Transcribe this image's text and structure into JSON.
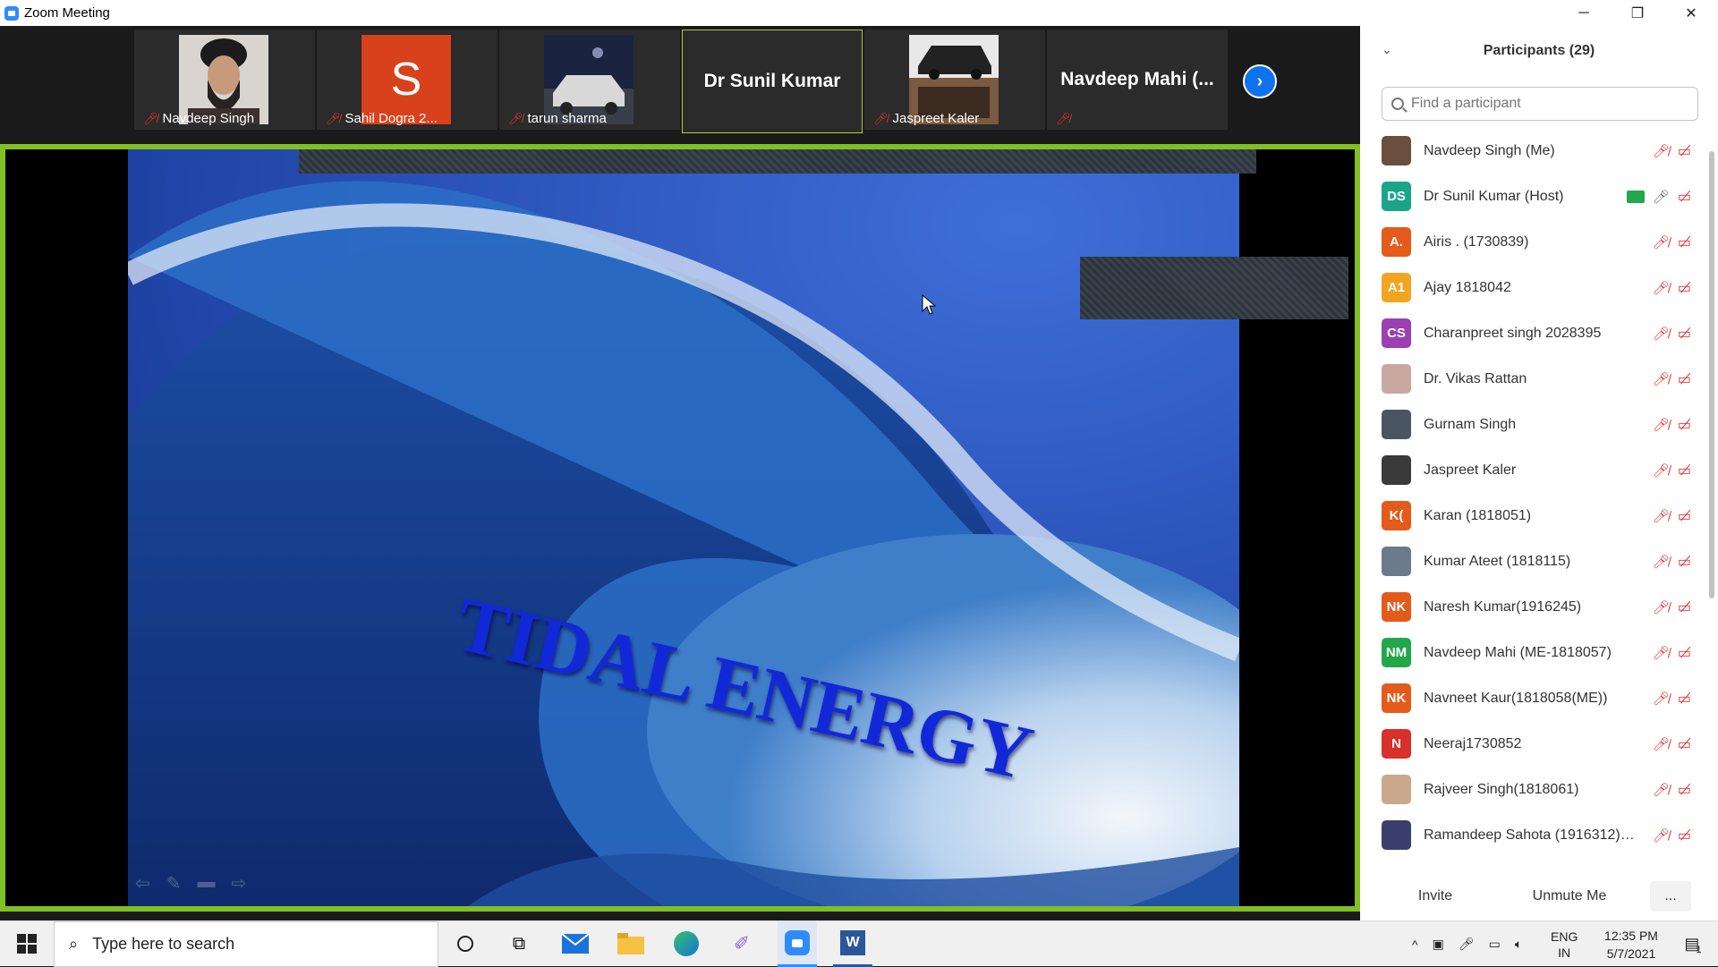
{
  "window": {
    "title": "Zoom Meeting",
    "minimize": "─",
    "restore": "❐",
    "close": "✕"
  },
  "strip": {
    "tiles": [
      {
        "name": "Navdeep Singh"
      },
      {
        "name": "Sahil Dogra 2...",
        "initial": "S"
      },
      {
        "name": "tarun sharma"
      },
      {
        "name": "Dr Sunil Kumar"
      },
      {
        "name": "Jaspreet Kaler"
      },
      {
        "name": "Navdeep  Mahi (..."
      }
    ],
    "next_icon": "chevron-right-icon"
  },
  "slide": {
    "title": "TIDAL ENERGY"
  },
  "sidebar": {
    "header": "Participants (29)",
    "search_placeholder": "Find a participant",
    "participants": [
      {
        "name": "Navdeep Singh (Me)",
        "initials": "",
        "color": "#6b4e3d"
      },
      {
        "name": "Dr Sunil Kumar (Host)",
        "initials": "DS",
        "color": "#1aa58b"
      },
      {
        "name": "Airis . (1730839)",
        "initials": "A.",
        "color": "#e45a1b"
      },
      {
        "name": "Ajay 1818042",
        "initials": "A1",
        "color": "#f2a521"
      },
      {
        "name": "Charanpreet singh 2028395",
        "initials": "CS",
        "color": "#9c3fb2"
      },
      {
        "name": "Dr. Vikas Rattan",
        "initials": "",
        "color": "#c9a8a0"
      },
      {
        "name": "Gurnam Singh",
        "initials": "",
        "color": "#4a5562"
      },
      {
        "name": "Jaspreet Kaler",
        "initials": "",
        "color": "#3a3a3a"
      },
      {
        "name": "Karan (1818051)",
        "initials": "K(",
        "color": "#e45a1b"
      },
      {
        "name": "Kumar Ateet (1818115)",
        "initials": "",
        "color": "#6c7a8c"
      },
      {
        "name": "Naresh Kumar(1916245)",
        "initials": "NK",
        "color": "#e45a1b"
      },
      {
        "name": "Navdeep Mahi (ME-1818057)",
        "initials": "NM",
        "color": "#22a84a"
      },
      {
        "name": "Navneet Kaur(1818058(ME))",
        "initials": "NK",
        "color": "#e45a1b"
      },
      {
        "name": "Neeraj1730852",
        "initials": "N",
        "color": "#d9302a"
      },
      {
        "name": "Rajveer Singh(1818061)",
        "initials": "",
        "color": "#caa88c"
      },
      {
        "name": "Ramandeep Sahota (1916312)M...",
        "initials": "",
        "color": "#3b3f6e"
      }
    ],
    "footer": {
      "invite": "Invite",
      "unmute": "Unmute Me",
      "more": "..."
    }
  },
  "taskbar": {
    "search_placeholder": "Type here to search",
    "lang_top": "ENG",
    "lang_bottom": "IN",
    "time": "12:35 PM",
    "date": "5/7/2021",
    "notifications": "1"
  }
}
